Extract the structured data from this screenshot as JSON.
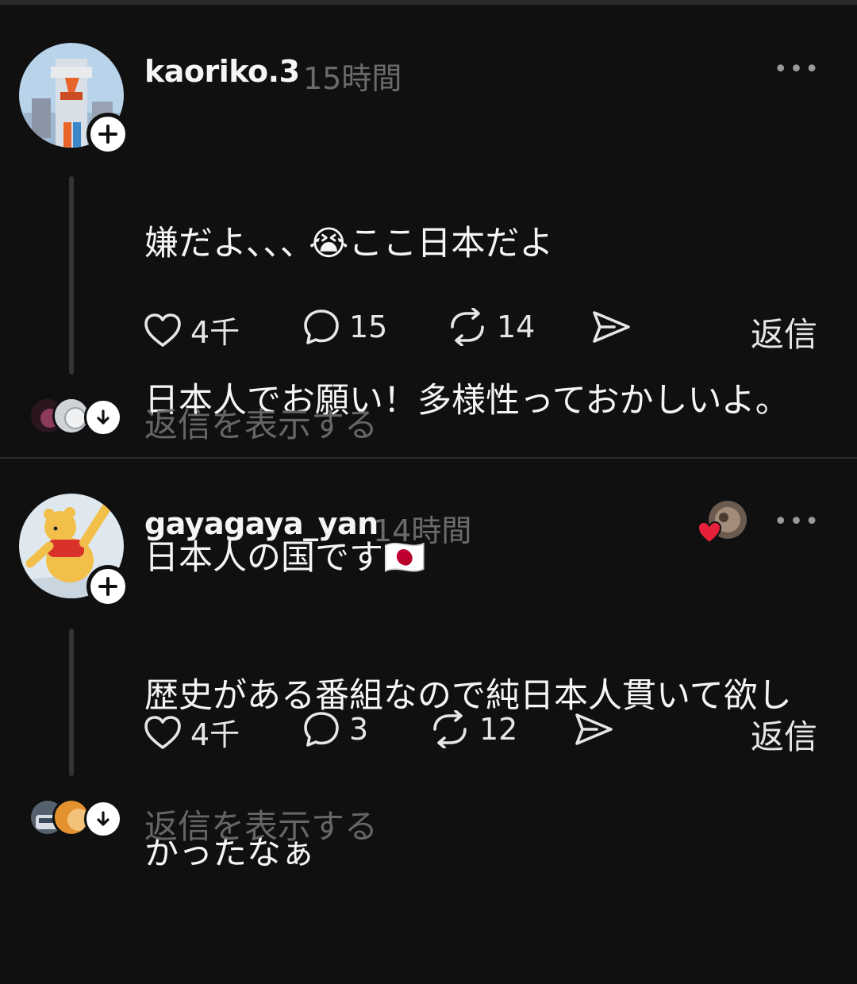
{
  "posts": [
    {
      "username": "kaoriko.3",
      "time": "15時間",
      "more": "•••",
      "lines": [
        "嫌だよ､､､ 😭ここ日本だよ",
        "日本人でお願い！多様性っておかしいよ。",
        "日本人の国です🇯🇵"
      ],
      "likes": "4千",
      "comments": "15",
      "reposts": "14",
      "reply_label": "返信",
      "show_replies": "返信を表示する"
    },
    {
      "username": "gayagaya_yan",
      "time": "14時間",
      "more": "•••",
      "lines": [
        "歴史がある番組なので純日本人貫いて欲し",
        "かったなぁ"
      ],
      "likes": "4千",
      "comments": "3",
      "reposts": "12",
      "reply_label": "返信",
      "show_replies": "返信を表示する"
    }
  ],
  "icons": {
    "like": "heart-icon",
    "comment": "comment-bubble-icon",
    "repost": "repost-icon",
    "share": "send-icon",
    "follow": "plus-icon",
    "expand": "arrow-down-icon",
    "liked_by_author": "red-heart-icon"
  },
  "colors": {
    "background": "#101010",
    "text": "#f3f5f7",
    "muted": "#6b6b6b",
    "heart": "#e8213a"
  }
}
